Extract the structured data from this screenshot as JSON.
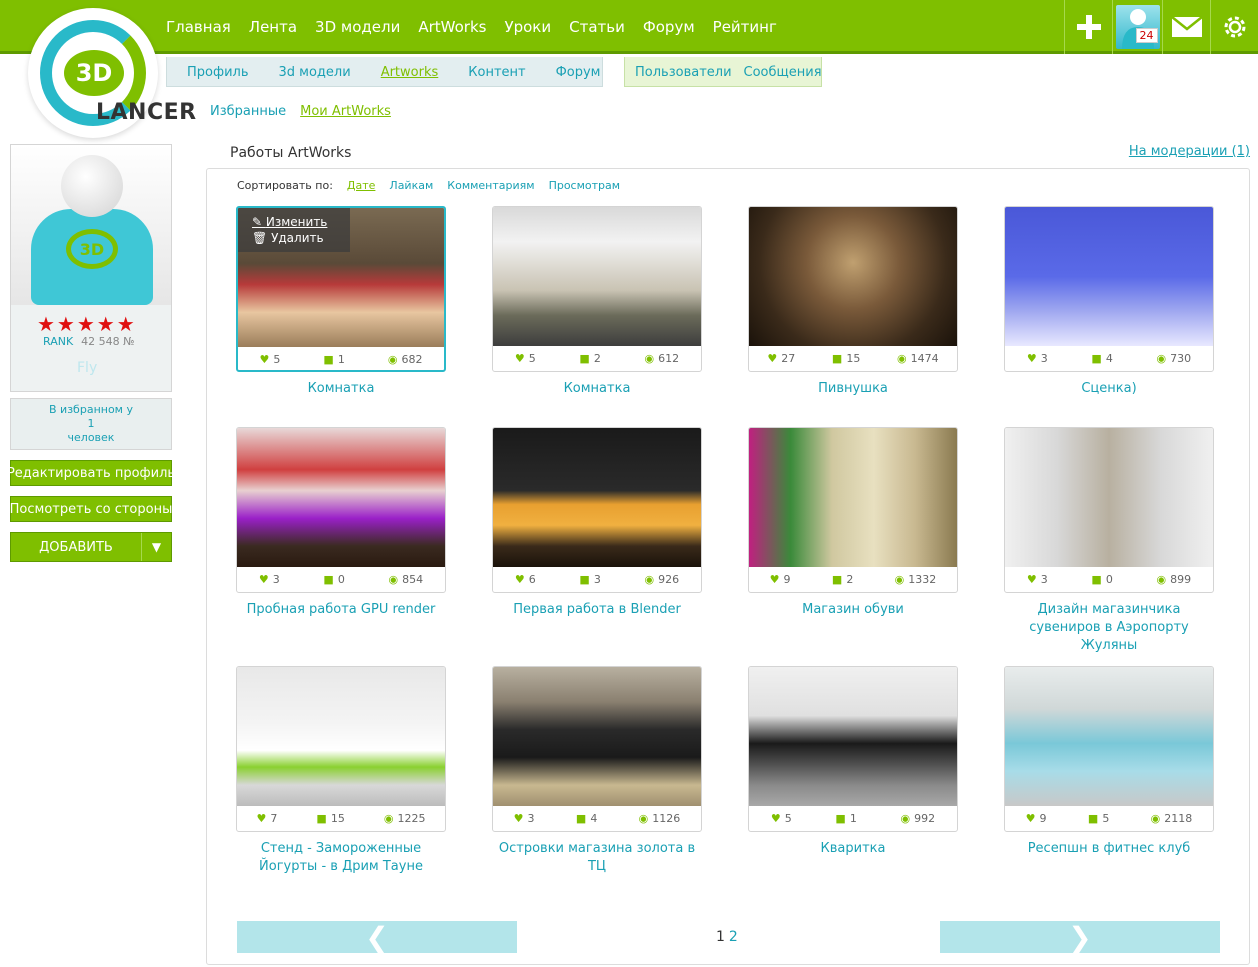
{
  "logo": {
    "mark": "3D",
    "text": "LANCER"
  },
  "main_nav": [
    "Главная",
    "Лента",
    "3D модели",
    "ArtWorks",
    "Уроки",
    "Статьи",
    "Форум",
    "Рейтинг"
  ],
  "top_icons": {
    "badge": "24"
  },
  "sub_nav": [
    {
      "label": "Профиль"
    },
    {
      "label": "3d модели"
    },
    {
      "label": "Artworks",
      "active": true
    },
    {
      "label": "Контент"
    },
    {
      "label": "Форум"
    }
  ],
  "sub_nav_right": [
    "Пользователи",
    "Сообщения"
  ],
  "sub_nav_third": [
    {
      "label": "Избранные"
    },
    {
      "label": "Мои ArtWorks",
      "active": true
    }
  ],
  "profile": {
    "stars": "★★★★★",
    "rank_label": "RANK",
    "rank_value": "42 548 №",
    "username": "Fly",
    "fav_line1": "В избранном у",
    "fav_count": "1",
    "fav_line2": "человек",
    "edit_label": "Редактировать профиль",
    "view_label": "Посмотреть со стороны",
    "add_label": "ДОБАВИТЬ"
  },
  "content": {
    "title": "Работы ArtWorks",
    "moderation": "На модерации (1)",
    "sort_label": "Сортировать по:",
    "sort_options": [
      {
        "label": "Дате",
        "active": true
      },
      {
        "label": "Лайкам"
      },
      {
        "label": "Комментариям"
      },
      {
        "label": "Просмотрам"
      }
    ],
    "overlay_edit": "Изменить",
    "overlay_delete": "Удалить",
    "works": [
      {
        "title": "Комнатка",
        "likes": "5",
        "comments": "1",
        "views": "682"
      },
      {
        "title": "Комнатка",
        "likes": "5",
        "comments": "2",
        "views": "612"
      },
      {
        "title": "Пивнушка",
        "likes": "27",
        "comments": "15",
        "views": "1474"
      },
      {
        "title": "Сценка)",
        "likes": "3",
        "comments": "4",
        "views": "730"
      },
      {
        "title": "Пробная работа GPU render",
        "likes": "3",
        "comments": "0",
        "views": "854"
      },
      {
        "title": "Первая работа в Blender",
        "likes": "6",
        "comments": "3",
        "views": "926"
      },
      {
        "title": "Магазин обуви",
        "likes": "9",
        "comments": "2",
        "views": "1332"
      },
      {
        "title": "Дизайн магазинчика сувениров в Аэропорту Жуляны",
        "likes": "3",
        "comments": "0",
        "views": "899"
      },
      {
        "title": "Стенд - Замороженные Йогурты - в Дрим Тауне",
        "likes": "7",
        "comments": "15",
        "views": "1225"
      },
      {
        "title": "Островки магазина золота в ТЦ",
        "likes": "3",
        "comments": "4",
        "views": "1126"
      },
      {
        "title": "Кваритка",
        "likes": "5",
        "comments": "1",
        "views": "992"
      },
      {
        "title": "Ресепшн в фитнес клуб",
        "likes": "9",
        "comments": "5",
        "views": "2118"
      }
    ],
    "pagination": {
      "current": "1",
      "next": "2"
    }
  }
}
